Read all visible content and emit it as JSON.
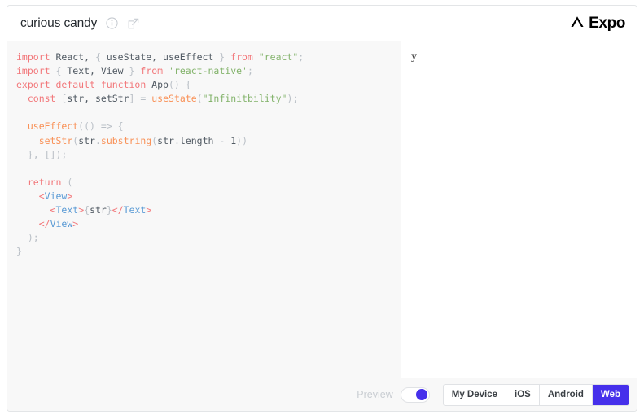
{
  "header": {
    "project_name": "curious candy",
    "info_icon": "info-circle-icon",
    "open_icon": "open-external-icon",
    "brand_word": "Expo",
    "brand_mark": "expo-chevron-icon"
  },
  "editor": {
    "language": "javascript",
    "lines": [
      [
        {
          "t": "import",
          "c": "kw"
        },
        {
          "t": " React, ",
          "c": "txt"
        },
        {
          "t": "{",
          "c": "pun"
        },
        {
          "t": " useState, useEffect ",
          "c": "txt"
        },
        {
          "t": "}",
          "c": "pun"
        },
        {
          "t": " ",
          "c": "txt"
        },
        {
          "t": "from",
          "c": "kw"
        },
        {
          "t": " ",
          "c": "txt"
        },
        {
          "t": "\"react\"",
          "c": "str"
        },
        {
          "t": ";",
          "c": "pun"
        }
      ],
      [
        {
          "t": "import",
          "c": "kw"
        },
        {
          "t": " ",
          "c": "txt"
        },
        {
          "t": "{",
          "c": "pun"
        },
        {
          "t": " Text, View ",
          "c": "txt"
        },
        {
          "t": "}",
          "c": "pun"
        },
        {
          "t": " ",
          "c": "txt"
        },
        {
          "t": "from",
          "c": "kw"
        },
        {
          "t": " ",
          "c": "txt"
        },
        {
          "t": "'react-native'",
          "c": "str"
        },
        {
          "t": ";",
          "c": "pun"
        }
      ],
      [
        {
          "t": "export default function",
          "c": "kw"
        },
        {
          "t": " App",
          "c": "txt"
        },
        {
          "t": "() {",
          "c": "pun"
        }
      ],
      [
        {
          "t": "  ",
          "c": "txt"
        },
        {
          "t": "const",
          "c": "kw"
        },
        {
          "t": " ",
          "c": "txt"
        },
        {
          "t": "[",
          "c": "pun"
        },
        {
          "t": "str, setStr",
          "c": "txt"
        },
        {
          "t": "]",
          "c": "pun"
        },
        {
          "t": " = ",
          "c": "pun"
        },
        {
          "t": "useState",
          "c": "fn"
        },
        {
          "t": "(",
          "c": "pun"
        },
        {
          "t": "\"Infinitbility\"",
          "c": "str"
        },
        {
          "t": ");",
          "c": "pun"
        }
      ],
      [],
      [
        {
          "t": "  ",
          "c": "txt"
        },
        {
          "t": "useEffect",
          "c": "fn"
        },
        {
          "t": "(() ",
          "c": "pun"
        },
        {
          "t": "=>",
          "c": "pun"
        },
        {
          "t": " {",
          "c": "pun"
        }
      ],
      [
        {
          "t": "    ",
          "c": "txt"
        },
        {
          "t": "setStr",
          "c": "fn"
        },
        {
          "t": "(",
          "c": "pun"
        },
        {
          "t": "str",
          "c": "txt"
        },
        {
          "t": ".",
          "c": "pun"
        },
        {
          "t": "substring",
          "c": "fn"
        },
        {
          "t": "(",
          "c": "pun"
        },
        {
          "t": "str",
          "c": "txt"
        },
        {
          "t": ".",
          "c": "pun"
        },
        {
          "t": "length",
          "c": "txt"
        },
        {
          "t": " - ",
          "c": "pun"
        },
        {
          "t": "1",
          "c": "txt"
        },
        {
          "t": "))",
          "c": "pun"
        }
      ],
      [
        {
          "t": "  }, []);",
          "c": "pun"
        }
      ],
      [],
      [
        {
          "t": "  ",
          "c": "txt"
        },
        {
          "t": "return",
          "c": "kw"
        },
        {
          "t": " (",
          "c": "pun"
        }
      ],
      [
        {
          "t": "    ",
          "c": "txt"
        },
        {
          "t": "<",
          "c": "kw"
        },
        {
          "t": "View",
          "c": "tag"
        },
        {
          "t": ">",
          "c": "kw"
        }
      ],
      [
        {
          "t": "      ",
          "c": "txt"
        },
        {
          "t": "<",
          "c": "kw"
        },
        {
          "t": "Text",
          "c": "tag"
        },
        {
          "t": ">",
          "c": "kw"
        },
        {
          "t": "{",
          "c": "pun"
        },
        {
          "t": "str",
          "c": "txt"
        },
        {
          "t": "}",
          "c": "pun"
        },
        {
          "t": "</",
          "c": "kw"
        },
        {
          "t": "Text",
          "c": "tag"
        },
        {
          "t": ">",
          "c": "kw"
        }
      ],
      [
        {
          "t": "    ",
          "c": "txt"
        },
        {
          "t": "</",
          "c": "kw"
        },
        {
          "t": "View",
          "c": "tag"
        },
        {
          "t": ">",
          "c": "kw"
        }
      ],
      [
        {
          "t": "  );",
          "c": "pun"
        }
      ],
      [
        {
          "t": "}",
          "c": "pun"
        }
      ]
    ]
  },
  "preview": {
    "rendered_text": "y"
  },
  "footer": {
    "preview_label": "Preview",
    "toggle_on": true,
    "platforms": [
      {
        "label": "My Device",
        "active": false
      },
      {
        "label": "iOS",
        "active": false
      },
      {
        "label": "Android",
        "active": false
      },
      {
        "label": "Web",
        "active": true
      }
    ]
  },
  "colors": {
    "accent": "#4630eb",
    "editor_bg": "#f8f8f8",
    "border": "#e3e5e7",
    "keyword": "#f2777a",
    "function": "#f99157",
    "string": "#83b36b",
    "tag": "#5b9bd5",
    "punctuation": "#b9bfc6",
    "text": "#515a63"
  }
}
